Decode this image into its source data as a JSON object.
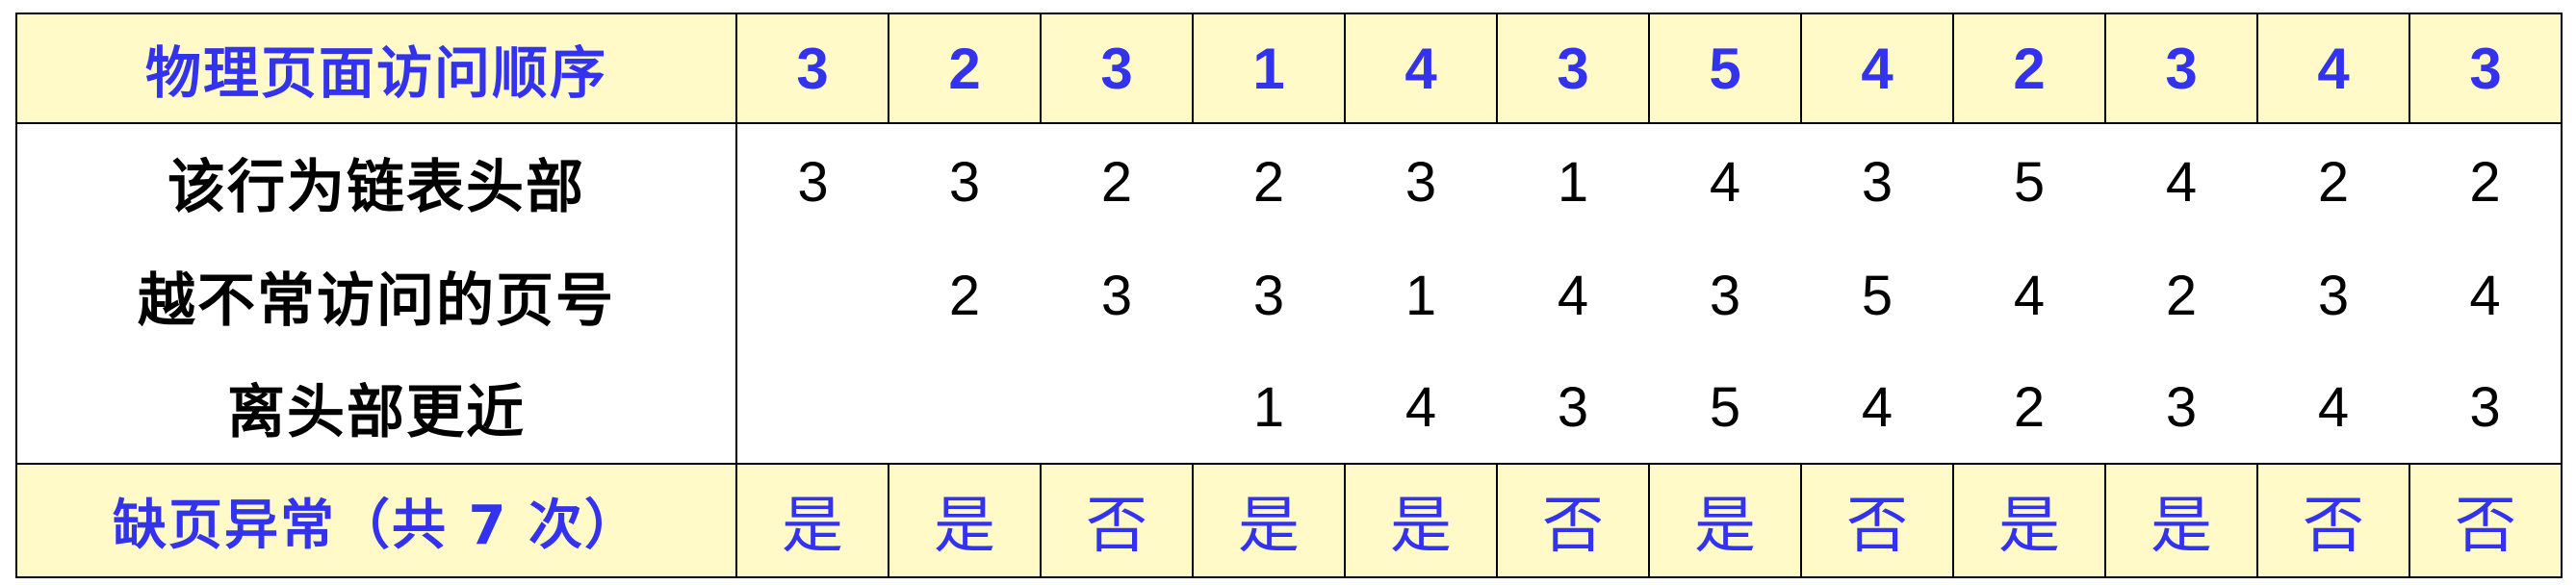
{
  "labels": {
    "access_order": "物理页面访问顺序",
    "row_head": "该行为链表头部",
    "row_mid": "越不常访问的页号",
    "row_tail": "离头部更近",
    "faults": "缺页异常（共 7 次）"
  },
  "access_sequence": [
    "3",
    "2",
    "3",
    "1",
    "4",
    "3",
    "5",
    "4",
    "2",
    "3",
    "4",
    "3"
  ],
  "lru_list": {
    "head": [
      "3",
      "3",
      "2",
      "2",
      "3",
      "1",
      "4",
      "3",
      "5",
      "4",
      "2",
      "2"
    ],
    "middle": [
      "",
      "2",
      "3",
      "3",
      "1",
      "4",
      "3",
      "5",
      "4",
      "2",
      "3",
      "4"
    ],
    "tail": [
      "",
      "",
      "",
      "1",
      "4",
      "3",
      "5",
      "4",
      "2",
      "3",
      "4",
      "3"
    ]
  },
  "page_faults": [
    "是",
    "是",
    "否",
    "是",
    "是",
    "否",
    "是",
    "否",
    "是",
    "是",
    "否",
    "否"
  ],
  "colors": {
    "header_bg": "#fffac8",
    "accent_blue": "#3333ee",
    "border": "#000000"
  }
}
